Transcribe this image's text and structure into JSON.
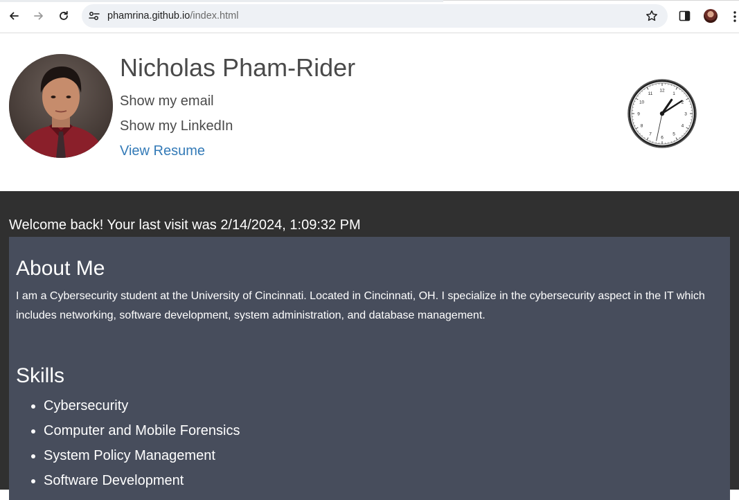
{
  "browser": {
    "url_host": "phamrina.github.io",
    "url_path": "/index.html"
  },
  "profile": {
    "name": "Nicholas Pham-Rider",
    "email_link": "Show my email",
    "linkedin_link": "Show my LinkedIn",
    "resume_link": "View Resume"
  },
  "clock": {
    "numbers": [
      "12",
      "1",
      "2",
      "3",
      "4",
      "5",
      "6",
      "7",
      "8",
      "9",
      "10",
      "11"
    ],
    "time": "1:09:32"
  },
  "welcome": "Welcome back! Your last visit was 2/14/2024, 1:09:32 PM",
  "about": {
    "title": "About Me",
    "text": "I am a Cybersecurity student at the University of Cincinnati. Located in Cincinnati, OH. I specialize in the cybersecurity aspect in the IT which includes networking, software development, system administration, and database management."
  },
  "skills": {
    "title": "Skills",
    "items": [
      "Cybersecurity",
      "Computer and Mobile Forensics",
      "System Policy Management",
      "Software Development"
    ]
  },
  "colors": {
    "dark_bg": "#303030",
    "panel_bg": "#474d5c",
    "link_blue": "#337ab7",
    "header_text": "#4a4a4a"
  },
  "icons": [
    "back-arrow-icon",
    "forward-arrow-icon",
    "reload-icon",
    "site-settings-icon",
    "bookmark-star-icon",
    "side-panel-icon",
    "profile-avatar-icon",
    "more-menu-icon"
  ]
}
